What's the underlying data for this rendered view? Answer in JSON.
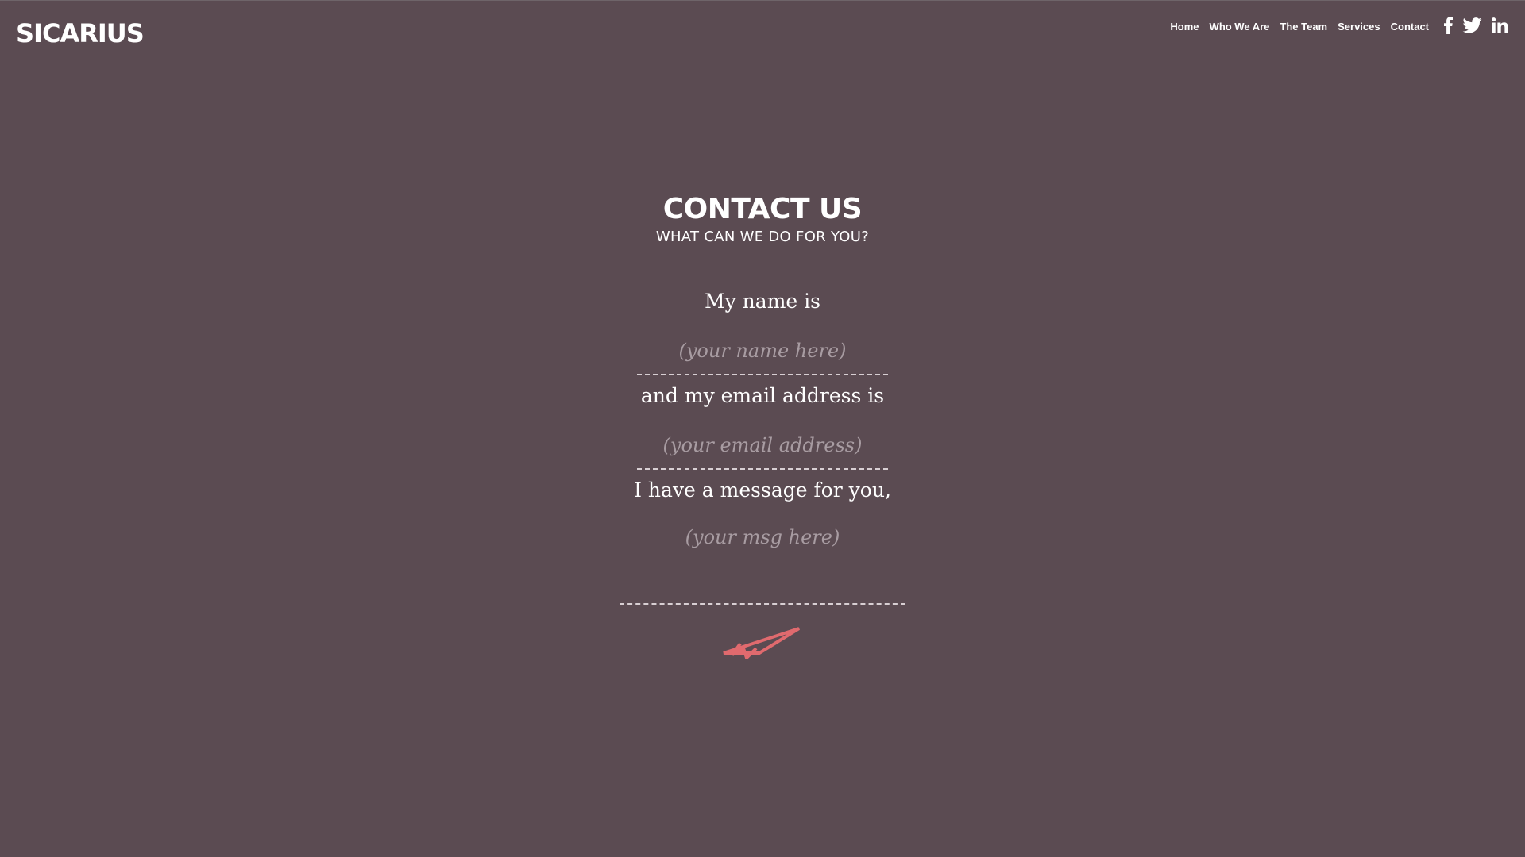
{
  "header": {
    "logo": "SICARIUS",
    "nav": [
      {
        "label": "Home"
      },
      {
        "label": "Who We Are"
      },
      {
        "label": "The Team"
      },
      {
        "label": "Services"
      },
      {
        "label": "Contact"
      }
    ],
    "social": [
      {
        "icon": "facebook-icon"
      },
      {
        "icon": "twitter-icon"
      },
      {
        "icon": "linkedin-icon"
      }
    ]
  },
  "contact": {
    "title": "CONTACT US",
    "subtitle": "WHAT CAN WE DO FOR YOU?",
    "name_label": "My name is",
    "name_placeholder": "(your name here)",
    "email_label": "and my email address is",
    "email_placeholder": "(your email address)",
    "message_label": "I have a message for you,",
    "message_placeholder": "(your msg here)",
    "send_icon": "paper-plane-icon"
  },
  "colors": {
    "background": "#5b4b52",
    "text": "#ffffff",
    "placeholder": "#a89ca2",
    "accent": "#e06a6e",
    "divider": "#d8cfd3"
  }
}
